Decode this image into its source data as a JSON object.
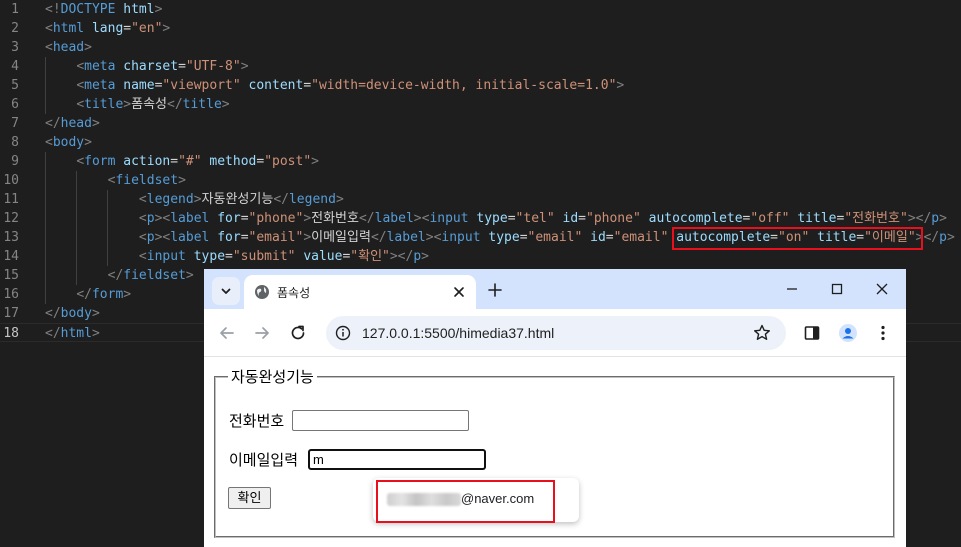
{
  "editor": {
    "line_numbers": [
      "1",
      "2",
      "3",
      "4",
      "5",
      "6",
      "7",
      "8",
      "9",
      "10",
      "11",
      "12",
      "13",
      "14",
      "15",
      "16",
      "17",
      "18"
    ],
    "current_line": "18",
    "lines": [
      [
        {
          "t": "br",
          "v": "<!"
        },
        {
          "t": "tag",
          "v": "DOCTYPE"
        },
        {
          "t": "tx",
          "v": " "
        },
        {
          "t": "at",
          "v": "html"
        },
        {
          "t": "br",
          "v": ">"
        }
      ],
      [
        {
          "t": "br",
          "v": "<"
        },
        {
          "t": "tag",
          "v": "html"
        },
        {
          "t": "tx",
          "v": " "
        },
        {
          "t": "at",
          "v": "lang"
        },
        {
          "t": "tx",
          "v": "="
        },
        {
          "t": "st",
          "v": "\"en\""
        },
        {
          "t": "br",
          "v": ">"
        }
      ],
      [
        {
          "t": "br",
          "v": "<"
        },
        {
          "t": "tag",
          "v": "head"
        },
        {
          "t": "br",
          "v": ">"
        }
      ],
      [
        {
          "t": "tx",
          "v": "    "
        },
        {
          "t": "br",
          "v": "<"
        },
        {
          "t": "tag",
          "v": "meta"
        },
        {
          "t": "tx",
          "v": " "
        },
        {
          "t": "at",
          "v": "charset"
        },
        {
          "t": "tx",
          "v": "="
        },
        {
          "t": "st",
          "v": "\"UTF-8\""
        },
        {
          "t": "br",
          "v": ">"
        }
      ],
      [
        {
          "t": "tx",
          "v": "    "
        },
        {
          "t": "br",
          "v": "<"
        },
        {
          "t": "tag",
          "v": "meta"
        },
        {
          "t": "tx",
          "v": " "
        },
        {
          "t": "at",
          "v": "name"
        },
        {
          "t": "tx",
          "v": "="
        },
        {
          "t": "st",
          "v": "\"viewport\""
        },
        {
          "t": "tx",
          "v": " "
        },
        {
          "t": "at",
          "v": "content"
        },
        {
          "t": "tx",
          "v": "="
        },
        {
          "t": "st",
          "v": "\"width=device-width, initial-scale=1.0\""
        },
        {
          "t": "br",
          "v": ">"
        }
      ],
      [
        {
          "t": "tx",
          "v": "    "
        },
        {
          "t": "br",
          "v": "<"
        },
        {
          "t": "tag",
          "v": "title"
        },
        {
          "t": "br",
          "v": ">"
        },
        {
          "t": "tx",
          "v": "폼속성"
        },
        {
          "t": "br",
          "v": "</"
        },
        {
          "t": "tag",
          "v": "title"
        },
        {
          "t": "br",
          "v": ">"
        }
      ],
      [
        {
          "t": "br",
          "v": "</"
        },
        {
          "t": "tag",
          "v": "head"
        },
        {
          "t": "br",
          "v": ">"
        }
      ],
      [
        {
          "t": "br",
          "v": "<"
        },
        {
          "t": "tag",
          "v": "body"
        },
        {
          "t": "br",
          "v": ">"
        }
      ],
      [
        {
          "t": "tx",
          "v": "    "
        },
        {
          "t": "br",
          "v": "<"
        },
        {
          "t": "tag",
          "v": "form"
        },
        {
          "t": "tx",
          "v": " "
        },
        {
          "t": "at",
          "v": "action"
        },
        {
          "t": "tx",
          "v": "="
        },
        {
          "t": "st",
          "v": "\"#\""
        },
        {
          "t": "tx",
          "v": " "
        },
        {
          "t": "at",
          "v": "method"
        },
        {
          "t": "tx",
          "v": "="
        },
        {
          "t": "st",
          "v": "\"post\""
        },
        {
          "t": "br",
          "v": ">"
        }
      ],
      [
        {
          "t": "tx",
          "v": "        "
        },
        {
          "t": "br",
          "v": "<"
        },
        {
          "t": "tag",
          "v": "fieldset"
        },
        {
          "t": "br",
          "v": ">"
        }
      ],
      [
        {
          "t": "tx",
          "v": "            "
        },
        {
          "t": "br",
          "v": "<"
        },
        {
          "t": "tag",
          "v": "legend"
        },
        {
          "t": "br",
          "v": ">"
        },
        {
          "t": "tx",
          "v": "자동완성기능"
        },
        {
          "t": "br",
          "v": "</"
        },
        {
          "t": "tag",
          "v": "legend"
        },
        {
          "t": "br",
          "v": ">"
        }
      ],
      [
        {
          "t": "tx",
          "v": "            "
        },
        {
          "t": "br",
          "v": "<"
        },
        {
          "t": "tag",
          "v": "p"
        },
        {
          "t": "br",
          "v": "><"
        },
        {
          "t": "tag",
          "v": "label"
        },
        {
          "t": "tx",
          "v": " "
        },
        {
          "t": "at",
          "v": "for"
        },
        {
          "t": "tx",
          "v": "="
        },
        {
          "t": "st",
          "v": "\"phone\""
        },
        {
          "t": "br",
          "v": ">"
        },
        {
          "t": "tx",
          "v": "전화번호"
        },
        {
          "t": "br",
          "v": "</"
        },
        {
          "t": "tag",
          "v": "label"
        },
        {
          "t": "br",
          "v": "><"
        },
        {
          "t": "tag",
          "v": "input"
        },
        {
          "t": "tx",
          "v": " "
        },
        {
          "t": "at",
          "v": "type"
        },
        {
          "t": "tx",
          "v": "="
        },
        {
          "t": "st",
          "v": "\"tel\""
        },
        {
          "t": "tx",
          "v": " "
        },
        {
          "t": "at",
          "v": "id"
        },
        {
          "t": "tx",
          "v": "="
        },
        {
          "t": "st",
          "v": "\"phone\""
        },
        {
          "t": "tx",
          "v": " "
        },
        {
          "t": "at",
          "v": "autocomplete"
        },
        {
          "t": "tx",
          "v": "="
        },
        {
          "t": "st",
          "v": "\"off\""
        },
        {
          "t": "tx",
          "v": " "
        },
        {
          "t": "at",
          "v": "title"
        },
        {
          "t": "tx",
          "v": "="
        },
        {
          "t": "st",
          "v": "\"전화번호\""
        },
        {
          "t": "br",
          "v": "></"
        },
        {
          "t": "tag",
          "v": "p"
        },
        {
          "t": "br",
          "v": ">"
        }
      ],
      [
        {
          "t": "tx",
          "v": "            "
        },
        {
          "t": "br",
          "v": "<"
        },
        {
          "t": "tag",
          "v": "p"
        },
        {
          "t": "br",
          "v": "><"
        },
        {
          "t": "tag",
          "v": "label"
        },
        {
          "t": "tx",
          "v": " "
        },
        {
          "t": "at",
          "v": "for"
        },
        {
          "t": "tx",
          "v": "="
        },
        {
          "t": "st",
          "v": "\"email\""
        },
        {
          "t": "br",
          "v": ">"
        },
        {
          "t": "tx",
          "v": "이메일입력"
        },
        {
          "t": "br",
          "v": "</"
        },
        {
          "t": "tag",
          "v": "label"
        },
        {
          "t": "br",
          "v": "><"
        },
        {
          "t": "tag",
          "v": "input"
        },
        {
          "t": "tx",
          "v": " "
        },
        {
          "t": "at",
          "v": "type"
        },
        {
          "t": "tx",
          "v": "="
        },
        {
          "t": "st",
          "v": "\"email\""
        },
        {
          "t": "tx",
          "v": " "
        },
        {
          "t": "at",
          "v": "id"
        },
        {
          "t": "tx",
          "v": "="
        },
        {
          "t": "st",
          "v": "\"email\""
        },
        {
          "t": "tx",
          "v": " "
        },
        {
          "t": "at",
          "v": "autocomplete"
        },
        {
          "t": "tx",
          "v": "="
        },
        {
          "t": "st",
          "v": "\"on\""
        },
        {
          "t": "tx",
          "v": " "
        },
        {
          "t": "at",
          "v": "title"
        },
        {
          "t": "tx",
          "v": "="
        },
        {
          "t": "st",
          "v": "\"이메일\""
        },
        {
          "t": "br",
          "v": "></"
        },
        {
          "t": "tag",
          "v": "p"
        },
        {
          "t": "br",
          "v": ">"
        }
      ],
      [
        {
          "t": "tx",
          "v": "            "
        },
        {
          "t": "br",
          "v": "<"
        },
        {
          "t": "tag",
          "v": "input"
        },
        {
          "t": "tx",
          "v": " "
        },
        {
          "t": "at",
          "v": "type"
        },
        {
          "t": "tx",
          "v": "="
        },
        {
          "t": "st",
          "v": "\"submit\""
        },
        {
          "t": "tx",
          "v": " "
        },
        {
          "t": "at",
          "v": "value"
        },
        {
          "t": "tx",
          "v": "="
        },
        {
          "t": "st",
          "v": "\"확인\""
        },
        {
          "t": "br",
          "v": "></"
        },
        {
          "t": "tag",
          "v": "p"
        },
        {
          "t": "br",
          "v": ">"
        }
      ],
      [
        {
          "t": "tx",
          "v": "        "
        },
        {
          "t": "br",
          "v": "</"
        },
        {
          "t": "tag",
          "v": "fieldset"
        },
        {
          "t": "br",
          "v": ">"
        }
      ],
      [
        {
          "t": "tx",
          "v": "    "
        },
        {
          "t": "br",
          "v": "</"
        },
        {
          "t": "tag",
          "v": "form"
        },
        {
          "t": "br",
          "v": ">"
        }
      ],
      [
        {
          "t": "br",
          "v": "</"
        },
        {
          "t": "tag",
          "v": "body"
        },
        {
          "t": "br",
          "v": ">"
        }
      ],
      [
        {
          "t": "br",
          "v": "</"
        },
        {
          "t": "tag",
          "v": "html"
        },
        {
          "t": "br",
          "v": ">"
        }
      ]
    ],
    "highlight_color": "#e8101c"
  },
  "browser": {
    "tab_title": "폼속성",
    "url": "127.0.0.1:5500/himedia37.html",
    "icons": {
      "tab_search": "chevron-down-icon",
      "favicon": "globe-icon",
      "tab_close": "close-icon",
      "new_tab": "plus-icon",
      "minimize": "minimize-icon",
      "maximize": "maximize-icon",
      "close": "window-close-icon",
      "back": "back-arrow-icon",
      "forward": "forward-arrow-icon",
      "reload": "reload-icon",
      "site_info": "info-icon",
      "bookmark": "star-icon",
      "side_panel": "side-panel-icon",
      "profile": "profile-icon",
      "menu": "more-vert-icon"
    },
    "colors": {
      "tabstrip": "#d3e3fd",
      "omnibox": "#edf2fa",
      "profile": "#1a73e8"
    }
  },
  "page": {
    "legend": "자동완성기능",
    "phone_label": "전화번호",
    "phone_value": "",
    "email_label": "이메일입력",
    "email_value": "m",
    "submit_label": "확인",
    "autofill_suggestion": "@naver.com"
  }
}
